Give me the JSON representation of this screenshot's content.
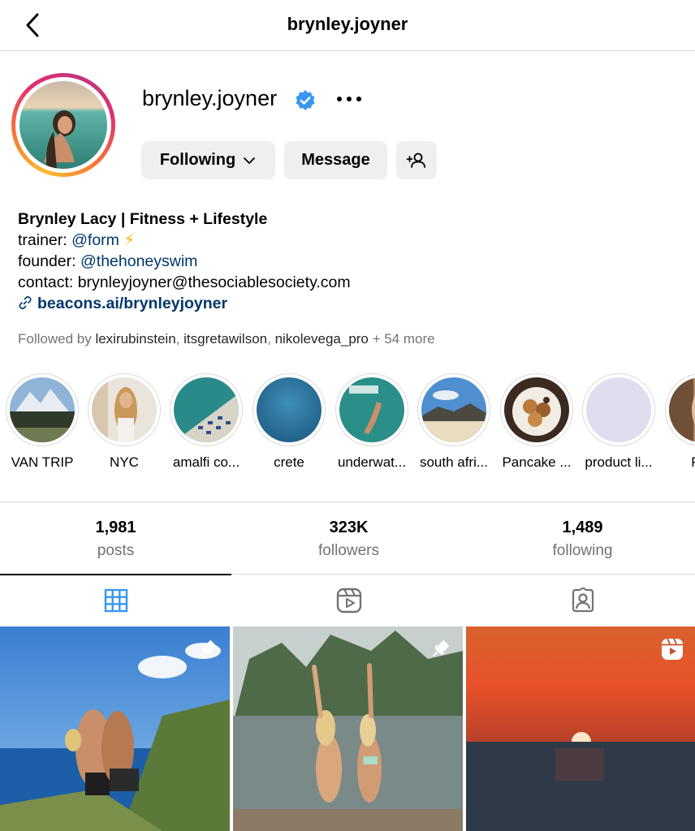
{
  "header": {
    "title": "brynley.joyner"
  },
  "profile": {
    "username": "brynley.joyner",
    "buttons": {
      "following": "Following",
      "message": "Message"
    }
  },
  "bio": {
    "name": "Brynley Lacy | Fitness + Lifestyle",
    "trainer_prefix": "trainer: ",
    "trainer_mention": "@form",
    "trainer_emoji": "⚡",
    "founder_prefix": "founder: ",
    "founder_mention": "@thehoneyswim",
    "contact": "contact: brynleyjoyner@thesociablesociety.com",
    "link": "beacons.ai/brynleyjoyner"
  },
  "followed_by": {
    "prefix": "Followed by ",
    "users": [
      "lexirubinstein",
      "itsgretawilson",
      "nikolevega_pro"
    ],
    "sep": ", ",
    "more": " + 54 more"
  },
  "highlights": [
    {
      "label": "VAN TRIP"
    },
    {
      "label": "NYC"
    },
    {
      "label": "amalfi co..."
    },
    {
      "label": "crete"
    },
    {
      "label": "underwat..."
    },
    {
      "label": "south afri..."
    },
    {
      "label": "Pancake ..."
    },
    {
      "label": "product li..."
    },
    {
      "label": "Fra"
    }
  ],
  "stats": [
    {
      "num": "1,981",
      "label": "posts"
    },
    {
      "num": "323K",
      "label": "followers"
    },
    {
      "num": "1,489",
      "label": "following"
    }
  ],
  "colors": {
    "accent": "#0095f6",
    "link": "#00376b",
    "verified": "#3897f0",
    "muted": "#737373",
    "button": "#efefef"
  }
}
